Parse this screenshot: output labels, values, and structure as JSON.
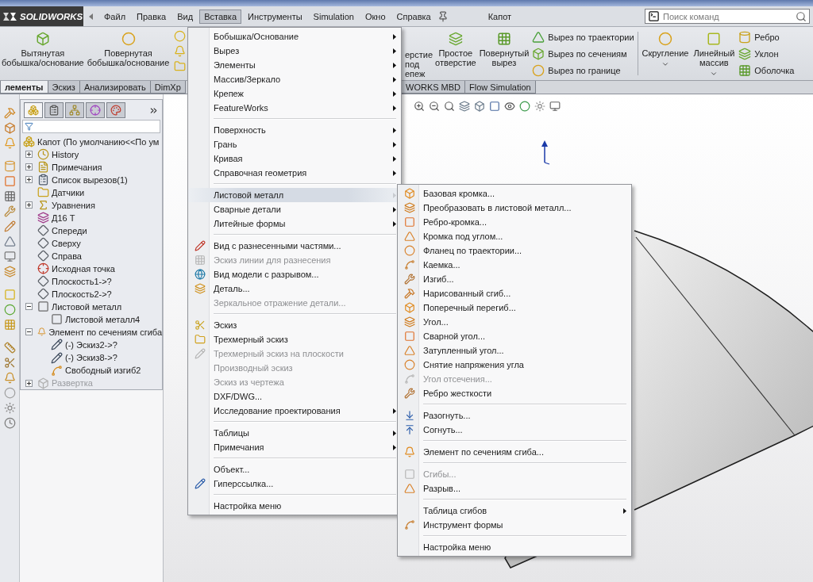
{
  "menu_bar": {
    "logo": "SOLIDWORKS",
    "items": [
      {
        "label": "Файл",
        "selected": false
      },
      {
        "label": "Правка",
        "selected": false
      },
      {
        "label": "Вид",
        "selected": false
      },
      {
        "label": "Вставка",
        "selected": true
      },
      {
        "label": "Инструменты",
        "selected": false
      },
      {
        "label": "Simulation",
        "selected": false
      },
      {
        "label": "Окно",
        "selected": false
      },
      {
        "label": "Справка",
        "selected": false
      }
    ],
    "document_title": "Капот",
    "search": {
      "placeholder": "Поиск команд"
    }
  },
  "command_manager": {
    "left": [
      {
        "kind": "large",
        "label": "Вытянутая\nбобышка/основание"
      },
      {
        "kind": "large",
        "label": "Повернутая\nбобышка/основание"
      },
      {
        "kind": "icons"
      }
    ],
    "right": [
      {
        "kind": "partial",
        "label": "ерстие\nпод\nепеж"
      },
      {
        "kind": "large",
        "label": "Простое\nотверстие"
      },
      {
        "kind": "large",
        "label": "Повернутый\nвырез"
      },
      {
        "kind": "stack",
        "items": [
          "Вырез по траектории",
          "Вырез по сечениям",
          "Вырез по границе"
        ]
      },
      {
        "kind": "separator"
      },
      {
        "kind": "dropdown",
        "label": "Скругление"
      },
      {
        "kind": "dropdown",
        "label": "Линейный\nмассив"
      },
      {
        "kind": "stack",
        "items": [
          "Ребро",
          "Уклон",
          "Оболочка"
        ]
      }
    ]
  },
  "tabs": {
    "left": [
      {
        "label": "лементы",
        "selected": true
      },
      {
        "label": "Эскиз",
        "selected": false
      },
      {
        "label": "Анализировать",
        "selected": false
      },
      {
        "label": "DimXp",
        "selected": false
      }
    ],
    "right": [
      {
        "label": "WORKS MBD",
        "selected": false
      },
      {
        "label": "Flow Simulation",
        "selected": false
      }
    ]
  },
  "feature_tree": {
    "panel_tabs": [
      {
        "selected": true
      },
      {
        "selected": false
      },
      {
        "selected": false
      },
      {
        "selected": false
      },
      {
        "selected": false
      }
    ],
    "root": {
      "label": "Капот  (По умолчанию<<По ум",
      "kind": "part",
      "disabled": false,
      "children": [
        {
          "label": "History",
          "kind": "history",
          "expandable": true,
          "expanded": false,
          "disabled": false
        },
        {
          "label": "Примечания",
          "kind": "notes",
          "expandable": true,
          "expanded": false,
          "disabled": false
        },
        {
          "label": "Список вырезов(1)",
          "kind": "cut_list",
          "expandable": true,
          "expanded": false,
          "disabled": false
        },
        {
          "label": "Датчики",
          "kind": "sensors",
          "expandable": false,
          "disabled": false
        },
        {
          "label": "Уравнения",
          "kind": "equations",
          "expandable": true,
          "expanded": false,
          "disabled": false
        },
        {
          "label": "Д16 Т",
          "kind": "material",
          "expandable": false,
          "disabled": false
        },
        {
          "label": "Спереди",
          "kind": "plane",
          "expandable": false,
          "disabled": false
        },
        {
          "label": "Сверху",
          "kind": "plane",
          "expandable": false,
          "disabled": false
        },
        {
          "label": "Справа",
          "kind": "plane",
          "expandable": false,
          "disabled": false
        },
        {
          "label": "Исходная точка",
          "kind": "origin",
          "expandable": false,
          "disabled": false
        },
        {
          "label": "Плоскость1->?",
          "kind": "plane",
          "expandable": false,
          "disabled": false
        },
        {
          "label": "Плоскость2->?",
          "kind": "plane",
          "expandable": false,
          "disabled": false
        },
        {
          "label": "Листовой металл",
          "kind": "sheet_metal",
          "expandable": true,
          "expanded": true,
          "disabled": false,
          "children": [
            {
              "label": "Листовой металл4",
              "kind": "sheet_metal",
              "expandable": false,
              "disabled": false
            }
          ]
        },
        {
          "label": "Элемент по сечениям сгиба",
          "kind": "loft_bend",
          "expandable": true,
          "expanded": true,
          "disabled": false,
          "children": [
            {
              "label": "(-) Эскиз2->?",
              "kind": "sketch",
              "expandable": false,
              "disabled": false
            },
            {
              "label": "(-) Эскиз8->?",
              "kind": "sketch",
              "expandable": false,
              "disabled": false
            },
            {
              "label": "Свободный изгиб2",
              "kind": "bend",
              "expandable": false,
              "disabled": false
            }
          ]
        },
        {
          "label": "Развертка",
          "kind": "flat",
          "expandable": true,
          "expanded": false,
          "disabled": true
        }
      ]
    }
  },
  "insert_menu": {
    "groups": [
      [
        {
          "label": "Бобышка/Основание",
          "submenu": true,
          "disabled": false,
          "selected": false,
          "icon": false
        },
        {
          "label": "Вырез",
          "submenu": true,
          "disabled": false,
          "selected": false,
          "icon": false
        },
        {
          "label": "Элементы",
          "submenu": true,
          "disabled": false,
          "selected": false,
          "icon": false
        },
        {
          "label": "Массив/Зеркало",
          "submenu": true,
          "disabled": false,
          "selected": false,
          "icon": false
        },
        {
          "label": "Крепеж",
          "submenu": true,
          "disabled": false,
          "selected": false,
          "icon": false
        },
        {
          "label": "FeatureWorks",
          "submenu": true,
          "disabled": false,
          "selected": false,
          "icon": false
        }
      ],
      [
        {
          "label": "Поверхность",
          "submenu": true,
          "disabled": false,
          "selected": false,
          "icon": false
        },
        {
          "label": "Грань",
          "submenu": true,
          "disabled": false,
          "selected": false,
          "icon": false
        },
        {
          "label": "Кривая",
          "submenu": true,
          "disabled": false,
          "selected": false,
          "icon": false
        },
        {
          "label": "Справочная геометрия",
          "submenu": true,
          "disabled": false,
          "selected": false,
          "icon": false
        }
      ],
      [
        {
          "label": "Листовой металл",
          "submenu": true,
          "disabled": false,
          "selected": true,
          "icon": false
        },
        {
          "label": "Сварные детали",
          "submenu": true,
          "disabled": false,
          "selected": false,
          "icon": false
        },
        {
          "label": "Литейные формы",
          "submenu": true,
          "disabled": false,
          "selected": false,
          "icon": false
        }
      ],
      [
        {
          "label": "Вид с разнесенными частями...",
          "submenu": false,
          "disabled": false,
          "selected": false,
          "icon": true
        },
        {
          "label": "Эскиз линии для разнесения",
          "submenu": false,
          "disabled": true,
          "selected": false,
          "icon": true
        },
        {
          "label": "Вид модели с разрывом...",
          "submenu": false,
          "disabled": false,
          "selected": false,
          "icon": true
        },
        {
          "label": "Деталь...",
          "submenu": false,
          "disabled": false,
          "selected": false,
          "icon": true
        },
        {
          "label": "Зеркальное отражение детали...",
          "submenu": false,
          "disabled": true,
          "selected": false,
          "icon": false
        }
      ],
      [
        {
          "label": "Эскиз",
          "submenu": false,
          "disabled": false,
          "selected": false,
          "icon": true
        },
        {
          "label": "Трехмерный эскиз",
          "submenu": false,
          "disabled": false,
          "selected": false,
          "icon": true
        },
        {
          "label": "Трехмерный эскиз на плоскости",
          "submenu": false,
          "disabled": true,
          "selected": false,
          "icon": true
        },
        {
          "label": "Производный эскиз",
          "submenu": false,
          "disabled": true,
          "selected": false,
          "icon": false
        },
        {
          "label": "Эскиз из чертежа",
          "submenu": false,
          "disabled": true,
          "selected": false,
          "icon": false
        },
        {
          "label": "DXF/DWG...",
          "submenu": false,
          "disabled": false,
          "selected": false,
          "icon": false
        },
        {
          "label": "Исследование проектирования",
          "submenu": true,
          "disabled": false,
          "selected": false,
          "icon": false
        }
      ],
      [
        {
          "label": "Таблицы",
          "submenu": true,
          "disabled": false,
          "selected": false,
          "icon": false
        },
        {
          "label": "Примечания",
          "submenu": true,
          "disabled": false,
          "selected": false,
          "icon": false
        }
      ],
      [
        {
          "label": "Объект...",
          "submenu": false,
          "disabled": false,
          "selected": false,
          "icon": false
        },
        {
          "label": "Гиперссылка...",
          "submenu": false,
          "disabled": false,
          "selected": false,
          "icon": true
        }
      ],
      [
        {
          "label": "Настройка меню",
          "submenu": false,
          "disabled": false,
          "selected": false,
          "icon": false
        }
      ]
    ]
  },
  "sheet_metal_submenu": {
    "groups": [
      [
        {
          "label": "Базовая кромка...",
          "submenu": false,
          "disabled": false,
          "selected": false,
          "icon": true
        },
        {
          "label": "Преобразовать в  листовой металл...",
          "submenu": false,
          "disabled": false,
          "selected": false,
          "icon": true
        },
        {
          "label": "Ребро-кромка...",
          "submenu": false,
          "disabled": false,
          "selected": false,
          "icon": true
        },
        {
          "label": "Кромка под углом...",
          "submenu": false,
          "disabled": false,
          "selected": false,
          "icon": true
        },
        {
          "label": "Фланец по траектории...",
          "submenu": false,
          "disabled": false,
          "selected": false,
          "icon": true
        },
        {
          "label": "Каемка...",
          "submenu": false,
          "disabled": false,
          "selected": false,
          "icon": true
        },
        {
          "label": "Изгиб...",
          "submenu": false,
          "disabled": false,
          "selected": false,
          "icon": true
        },
        {
          "label": "Нарисованный сгиб...",
          "submenu": false,
          "disabled": false,
          "selected": false,
          "icon": true
        },
        {
          "label": "Поперечный перегиб...",
          "submenu": false,
          "disabled": false,
          "selected": false,
          "icon": true
        },
        {
          "label": "Угол...",
          "submenu": false,
          "disabled": false,
          "selected": false,
          "icon": true
        },
        {
          "label": "Сварной угол...",
          "submenu": false,
          "disabled": false,
          "selected": false,
          "icon": true
        },
        {
          "label": "Затупленный угол...",
          "submenu": false,
          "disabled": false,
          "selected": false,
          "icon": true
        },
        {
          "label": "Снятие напряжения угла",
          "submenu": false,
          "disabled": false,
          "selected": false,
          "icon": true
        },
        {
          "label": "Угол отсечения...",
          "submenu": false,
          "disabled": true,
          "selected": false,
          "icon": true
        },
        {
          "label": "Ребро жесткости",
          "submenu": false,
          "disabled": false,
          "selected": false,
          "icon": true
        }
      ],
      [
        {
          "label": "Разогнуть...",
          "submenu": false,
          "disabled": false,
          "selected": false,
          "icon": true
        },
        {
          "label": "Согнуть...",
          "submenu": false,
          "disabled": false,
          "selected": false,
          "icon": true
        }
      ],
      [
        {
          "label": "Элемент по сечениям сгиба...",
          "submenu": false,
          "disabled": false,
          "selected": false,
          "icon": true
        }
      ],
      [
        {
          "label": "Сгибы...",
          "submenu": false,
          "disabled": true,
          "selected": false,
          "icon": true
        },
        {
          "label": "Разрыв...",
          "submenu": false,
          "disabled": false,
          "selected": false,
          "icon": true
        }
      ],
      [
        {
          "label": "Таблица сгибов",
          "submenu": true,
          "disabled": false,
          "selected": false,
          "icon": false
        },
        {
          "label": "Инструмент формы",
          "submenu": false,
          "disabled": false,
          "selected": false,
          "icon": true
        }
      ],
      [
        {
          "label": "Настройка меню",
          "submenu": false,
          "disabled": false,
          "selected": false,
          "icon": false
        }
      ]
    ]
  }
}
